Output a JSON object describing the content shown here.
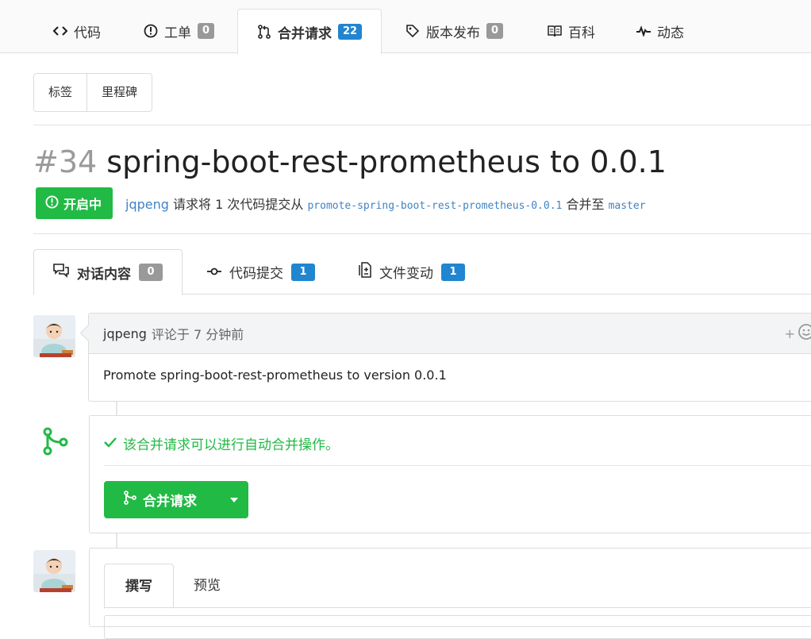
{
  "repo_tabs": [
    {
      "label": "代码",
      "icon": "code-icon"
    },
    {
      "label": "工单",
      "icon": "issue-icon",
      "count": "0"
    },
    {
      "label": "合并请求",
      "icon": "pull-request-icon",
      "count": "22",
      "active": true
    },
    {
      "label": "版本发布",
      "icon": "tag-icon",
      "count": "0"
    },
    {
      "label": "百科",
      "icon": "book-icon"
    },
    {
      "label": "动态",
      "icon": "pulse-icon"
    }
  ],
  "filters": {
    "labels": "标签",
    "milestones": "里程碑"
  },
  "pr": {
    "number": "#34",
    "title": "spring-boot-rest-prometheus to 0.0.1",
    "state": "开启中",
    "author": "jqpeng",
    "summary_a": "请求将 1 次代码提交从",
    "head_branch": "promote-spring-boot-rest-prometheus-0.0.1",
    "summary_b": "合并至",
    "base_branch": "master"
  },
  "pr_tabs": [
    {
      "label": "对话内容",
      "icon": "comments-icon",
      "count": "0",
      "active": true
    },
    {
      "label": "代码提交",
      "icon": "commit-icon",
      "count": "1"
    },
    {
      "label": "文件变动",
      "icon": "file-diff-icon",
      "count": "1"
    }
  ],
  "comment": {
    "author": "jqpeng",
    "meta": "评论于 7 分钟前",
    "body": "Promote spring-boot-rest-prometheus to version 0.0.1",
    "add_reaction": "+"
  },
  "merge": {
    "status": "该合并请求可以进行自动合并操作。",
    "button": "合并请求"
  },
  "editor": {
    "write_tab": "撰写",
    "preview_tab": "预览"
  },
  "colors": {
    "green": "#21ba45",
    "blue": "#2185d0",
    "link": "#4183c4",
    "badge_gray": "#999999"
  }
}
